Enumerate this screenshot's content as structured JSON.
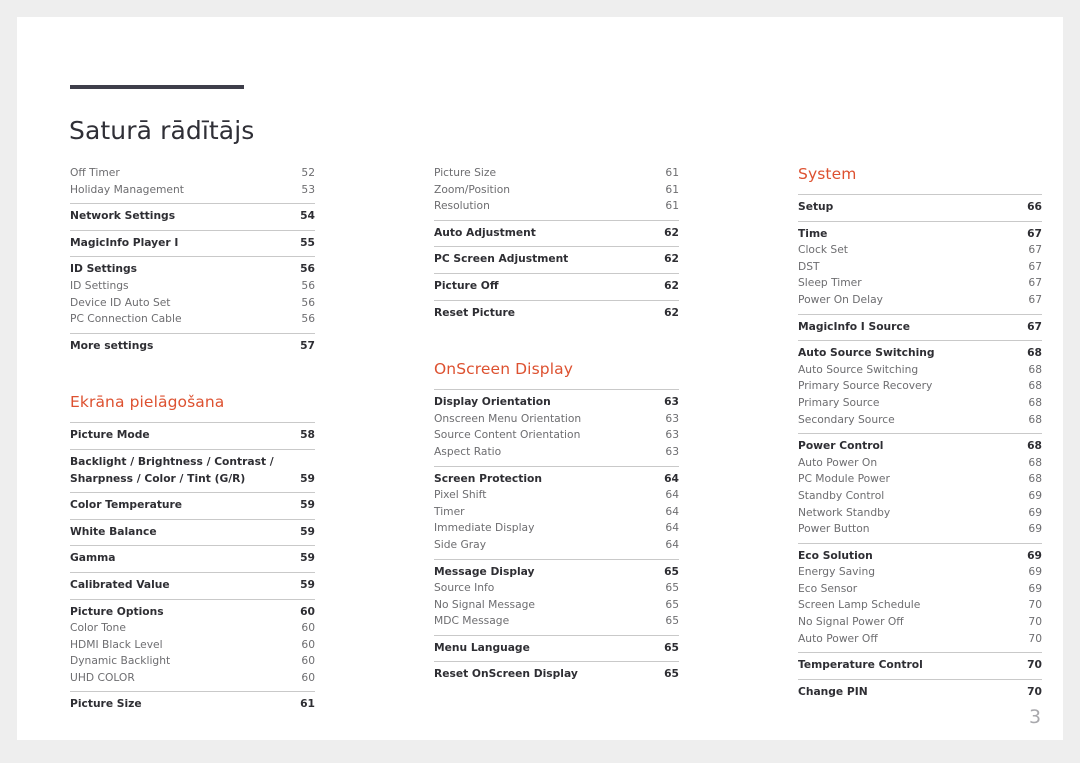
{
  "document": {
    "title": "Saturā rādītājs",
    "page_number": "3",
    "accent_color": "#dd5130",
    "rule_color": "#3e3e4a",
    "body_color": "#6d6d70",
    "heading_color": "#2e2e33"
  },
  "columns": [
    {
      "id": "column-1",
      "blocks": [
        {
          "type": "group",
          "rule": false,
          "rows": [
            {
              "label": "Off Timer",
              "page": "52",
              "level": "sub"
            },
            {
              "label": "Holiday Management",
              "page": "53",
              "level": "sub"
            }
          ]
        },
        {
          "type": "group",
          "rule": true,
          "rows": [
            {
              "label": "Network Settings",
              "page": "54",
              "level": "head"
            }
          ]
        },
        {
          "type": "group",
          "rule": true,
          "rows": [
            {
              "label": "MagicInfo Player I",
              "page": "55",
              "level": "head"
            }
          ]
        },
        {
          "type": "group",
          "rule": true,
          "rows": [
            {
              "label": "ID Settings",
              "page": "56",
              "level": "head"
            },
            {
              "label": "ID Settings",
              "page": "56",
              "level": "sub"
            },
            {
              "label": "Device ID Auto Set",
              "page": "56",
              "level": "sub"
            },
            {
              "label": "PC Connection Cable",
              "page": "56",
              "level": "sub"
            }
          ]
        },
        {
          "type": "group",
          "rule": true,
          "rows": [
            {
              "label": "More settings",
              "page": "57",
              "level": "head"
            }
          ]
        },
        {
          "type": "heading",
          "label": "Ekrāna pielāgošana"
        },
        {
          "type": "group",
          "rule": true,
          "rows": [
            {
              "label": "Picture Mode",
              "page": "58",
              "level": "head"
            }
          ]
        },
        {
          "type": "group",
          "rule": true,
          "rows": [
            {
              "label": "Backlight / Brightness / Contrast / Sharpness / Color / Tint (G/R)",
              "page": "59",
              "level": "head",
              "wrap": true
            }
          ]
        },
        {
          "type": "group",
          "rule": true,
          "rows": [
            {
              "label": "Color Temperature",
              "page": "59",
              "level": "head"
            }
          ]
        },
        {
          "type": "group",
          "rule": true,
          "rows": [
            {
              "label": "White Balance",
              "page": "59",
              "level": "head"
            }
          ]
        },
        {
          "type": "group",
          "rule": true,
          "rows": [
            {
              "label": "Gamma",
              "page": "59",
              "level": "head"
            }
          ]
        },
        {
          "type": "group",
          "rule": true,
          "rows": [
            {
              "label": "Calibrated Value",
              "page": "59",
              "level": "head"
            }
          ]
        },
        {
          "type": "group",
          "rule": true,
          "rows": [
            {
              "label": "Picture Options",
              "page": "60",
              "level": "head"
            },
            {
              "label": "Color Tone",
              "page": "60",
              "level": "sub"
            },
            {
              "label": "HDMI Black Level",
              "page": "60",
              "level": "sub"
            },
            {
              "label": "Dynamic Backlight",
              "page": "60",
              "level": "sub"
            },
            {
              "label": "UHD COLOR",
              "page": "60",
              "level": "sub"
            }
          ]
        },
        {
          "type": "group",
          "rule": true,
          "rows": [
            {
              "label": "Picture Size",
              "page": "61",
              "level": "head"
            }
          ]
        }
      ]
    },
    {
      "id": "column-2",
      "blocks": [
        {
          "type": "group",
          "rule": false,
          "rows": [
            {
              "label": "Picture Size",
              "page": "61",
              "level": "sub"
            },
            {
              "label": "Zoom/Position",
              "page": "61",
              "level": "sub"
            },
            {
              "label": "Resolution",
              "page": "61",
              "level": "sub"
            }
          ]
        },
        {
          "type": "group",
          "rule": true,
          "rows": [
            {
              "label": "Auto Adjustment",
              "page": "62",
              "level": "head"
            }
          ]
        },
        {
          "type": "group",
          "rule": true,
          "rows": [
            {
              "label": "PC Screen Adjustment",
              "page": "62",
              "level": "head"
            }
          ]
        },
        {
          "type": "group",
          "rule": true,
          "rows": [
            {
              "label": "Picture Off",
              "page": "62",
              "level": "head"
            }
          ]
        },
        {
          "type": "group",
          "rule": true,
          "rows": [
            {
              "label": "Reset Picture",
              "page": "62",
              "level": "head"
            }
          ]
        },
        {
          "type": "heading",
          "label": "OnScreen Display"
        },
        {
          "type": "group",
          "rule": true,
          "rows": [
            {
              "label": "Display Orientation",
              "page": "63",
              "level": "head"
            },
            {
              "label": "Onscreen Menu Orientation",
              "page": "63",
              "level": "sub"
            },
            {
              "label": "Source Content Orientation",
              "page": "63",
              "level": "sub"
            },
            {
              "label": "Aspect Ratio",
              "page": "63",
              "level": "sub"
            }
          ]
        },
        {
          "type": "group",
          "rule": true,
          "rows": [
            {
              "label": "Screen Protection",
              "page": "64",
              "level": "head"
            },
            {
              "label": "Pixel Shift",
              "page": "64",
              "level": "sub"
            },
            {
              "label": "Timer",
              "page": "64",
              "level": "sub"
            },
            {
              "label": "Immediate Display",
              "page": "64",
              "level": "sub"
            },
            {
              "label": "Side Gray",
              "page": "64",
              "level": "sub"
            }
          ]
        },
        {
          "type": "group",
          "rule": true,
          "rows": [
            {
              "label": "Message Display",
              "page": "65",
              "level": "head"
            },
            {
              "label": "Source Info",
              "page": "65",
              "level": "sub"
            },
            {
              "label": "No Signal Message",
              "page": "65",
              "level": "sub"
            },
            {
              "label": "MDC Message",
              "page": "65",
              "level": "sub"
            }
          ]
        },
        {
          "type": "group",
          "rule": true,
          "rows": [
            {
              "label": "Menu Language",
              "page": "65",
              "level": "head"
            }
          ]
        },
        {
          "type": "group",
          "rule": true,
          "rows": [
            {
              "label": "Reset OnScreen Display",
              "page": "65",
              "level": "head"
            }
          ]
        }
      ]
    },
    {
      "id": "column-3",
      "blocks": [
        {
          "type": "heading",
          "label": "System"
        },
        {
          "type": "group",
          "rule": true,
          "rows": [
            {
              "label": "Setup",
              "page": "66",
              "level": "head"
            }
          ]
        },
        {
          "type": "group",
          "rule": true,
          "rows": [
            {
              "label": "Time",
              "page": "67",
              "level": "head"
            },
            {
              "label": "Clock Set",
              "page": "67",
              "level": "sub"
            },
            {
              "label": "DST",
              "page": "67",
              "level": "sub"
            },
            {
              "label": "Sleep Timer",
              "page": "67",
              "level": "sub"
            },
            {
              "label": "Power On Delay",
              "page": "67",
              "level": "sub"
            }
          ]
        },
        {
          "type": "group",
          "rule": true,
          "rows": [
            {
              "label": "MagicInfo I Source",
              "page": "67",
              "level": "head"
            }
          ]
        },
        {
          "type": "group",
          "rule": true,
          "rows": [
            {
              "label": "Auto Source Switching",
              "page": "68",
              "level": "head"
            },
            {
              "label": "Auto Source Switching",
              "page": "68",
              "level": "sub"
            },
            {
              "label": "Primary Source Recovery",
              "page": "68",
              "level": "sub"
            },
            {
              "label": "Primary Source",
              "page": "68",
              "level": "sub"
            },
            {
              "label": "Secondary Source",
              "page": "68",
              "level": "sub"
            }
          ]
        },
        {
          "type": "group",
          "rule": true,
          "rows": [
            {
              "label": "Power Control",
              "page": "68",
              "level": "head"
            },
            {
              "label": "Auto Power On",
              "page": "68",
              "level": "sub"
            },
            {
              "label": "PC Module Power",
              "page": "68",
              "level": "sub"
            },
            {
              "label": "Standby Control",
              "page": "69",
              "level": "sub"
            },
            {
              "label": "Network Standby",
              "page": "69",
              "level": "sub"
            },
            {
              "label": "Power Button",
              "page": "69",
              "level": "sub"
            }
          ]
        },
        {
          "type": "group",
          "rule": true,
          "rows": [
            {
              "label": "Eco Solution",
              "page": "69",
              "level": "head"
            },
            {
              "label": "Energy Saving",
              "page": "69",
              "level": "sub"
            },
            {
              "label": "Eco Sensor",
              "page": "69",
              "level": "sub"
            },
            {
              "label": "Screen Lamp Schedule",
              "page": "70",
              "level": "sub"
            },
            {
              "label": "No Signal Power Off",
              "page": "70",
              "level": "sub"
            },
            {
              "label": "Auto Power Off",
              "page": "70",
              "level": "sub"
            }
          ]
        },
        {
          "type": "group",
          "rule": true,
          "rows": [
            {
              "label": "Temperature Control",
              "page": "70",
              "level": "head"
            }
          ]
        },
        {
          "type": "group",
          "rule": true,
          "rows": [
            {
              "label": "Change PIN",
              "page": "70",
              "level": "head"
            }
          ]
        }
      ]
    }
  ]
}
